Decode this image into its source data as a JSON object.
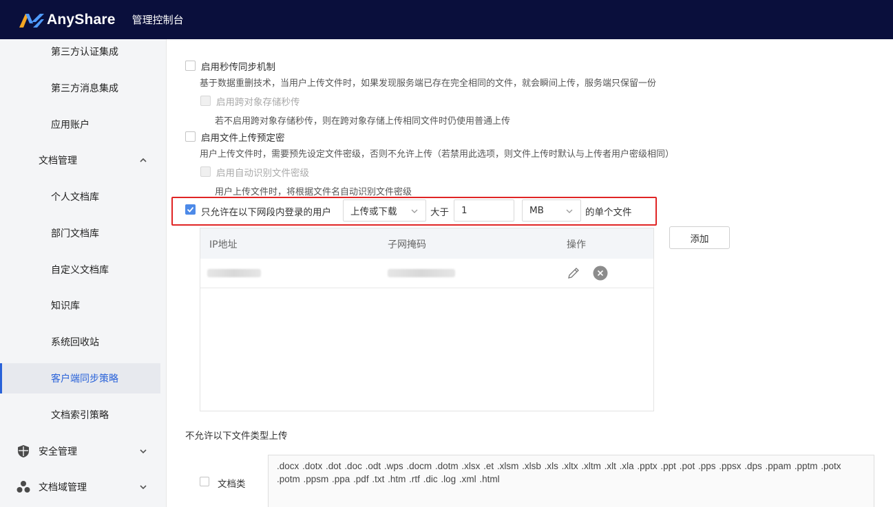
{
  "header": {
    "logo_text": "AnyShare",
    "title": "管理控制台"
  },
  "sidebar": {
    "items": [
      {
        "label": "第三方认证集成"
      },
      {
        "label": "第三方消息集成"
      },
      {
        "label": "应用账户"
      },
      {
        "label": "文档管理"
      },
      {
        "label": "个人文档库"
      },
      {
        "label": "部门文档库"
      },
      {
        "label": "自定义文档库"
      },
      {
        "label": "知识库"
      },
      {
        "label": "系统回收站"
      },
      {
        "label": "客户端同步策略"
      },
      {
        "label": "文档索引策略"
      },
      {
        "label": "安全管理"
      },
      {
        "label": "文档域管理"
      }
    ]
  },
  "settings": {
    "instant_upload": {
      "label": "启用秒传同步机制",
      "desc": "基于数据重删技术，当用户上传文件时，如果发现服务端已存在完全相同的文件，就会瞬间上传，服务端只保留一份",
      "checked": false
    },
    "cross_storage": {
      "label": "启用跨对象存储秒传",
      "desc": "若不启用跨对象存储秒传，则在跨对象存储上传相同文件时仍使用普通上传",
      "disabled": true
    },
    "preset_classification": {
      "label": "启用文件上传预定密",
      "desc": "用户上传文件时，需要预先设定文件密级，否则不允许上传（若禁用此选项，则文件上传时默认与上传者用户密级相同）",
      "checked": false
    },
    "auto_classification": {
      "label": "启用自动识别文件密级",
      "desc": "用户上传文件时，将根据文件名自动识别文件密级",
      "disabled": true
    },
    "network_restrict": {
      "label": "只允许在以下网段内登录的用户",
      "checked": true,
      "mode_value": "上传或下载",
      "greater_than": "大于",
      "size_value": "1",
      "unit_value": "MB",
      "suffix": "的单个文件"
    }
  },
  "ip_table": {
    "columns": [
      "IP地址",
      "子网掩码",
      "操作"
    ],
    "add_label": "添加"
  },
  "file_types": {
    "section_label": "不允许以下文件类型上传",
    "category_label": "文档类",
    "extensions": ".docx .dotx .dot .doc .odt .wps .docm .dotm .xlsx .et .xlsm .xlsb .xls .xltx .xltm .xlt .xla .pptx .ppt .pot .pps .ppsx .dps .ppam .pptm .potx .potm .ppsm .ppa .pdf .txt .htm .rtf .dic .log .xml .html"
  },
  "colors": {
    "topbar": "#0a0f3c",
    "accent": "#2962d9",
    "highlight": "#e02424"
  }
}
